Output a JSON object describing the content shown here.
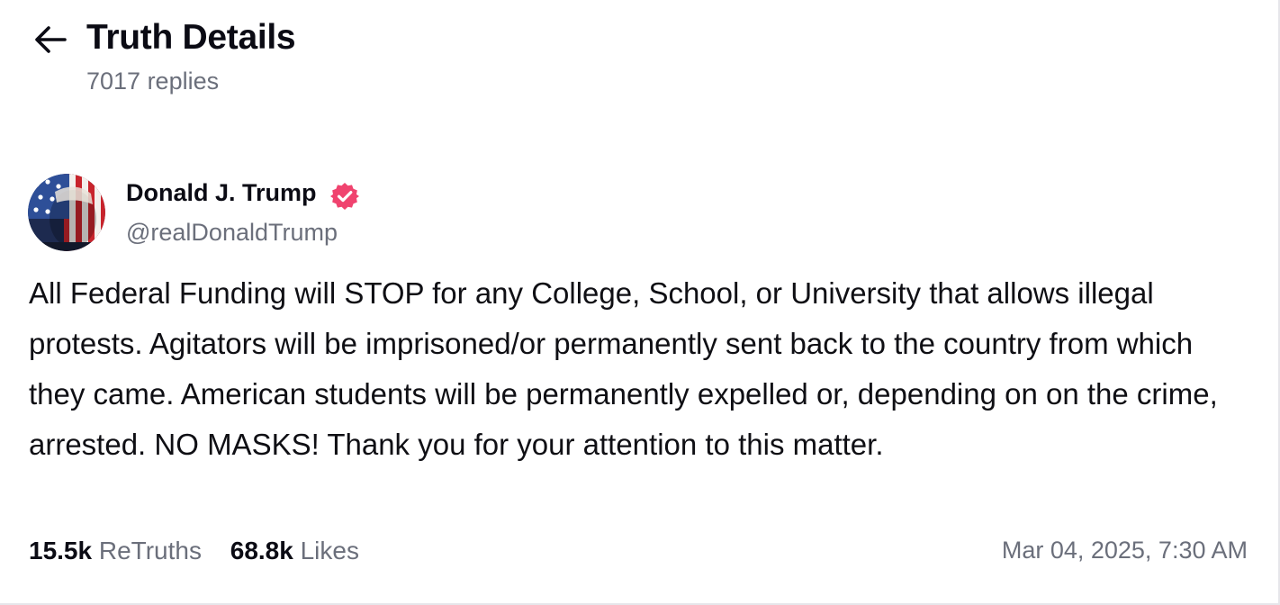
{
  "header": {
    "title": "Truth Details",
    "replies": "7017 replies"
  },
  "author": {
    "display_name": "Donald J. Trump",
    "handle": "@realDonaldTrump",
    "verified_icon": "verified-badge-icon",
    "verified_color": "#f0436f"
  },
  "post": {
    "text": "All Federal Funding will STOP for any College, School, or University that allows illegal protests. Agitators will be imprisoned/or permanently sent back to the country from which they came. American students will be permanently expelled or, depending on on the crime, arrested. NO MASKS! Thank you for your attention to this matter."
  },
  "stats": {
    "retruths_count": "15.5k",
    "retruths_label": "ReTruths",
    "likes_count": "68.8k",
    "likes_label": "Likes"
  },
  "timestamp": "Mar 04, 2025, 7:30 AM",
  "colors": {
    "text_primary": "#0b0b14",
    "text_secondary": "#6b6f7b",
    "accent": "#f0436f"
  }
}
